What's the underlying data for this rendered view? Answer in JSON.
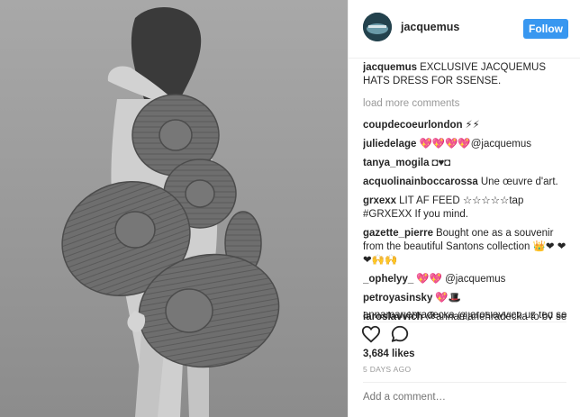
{
  "header": {
    "username": "jacquemus",
    "follow_label": "Follow"
  },
  "caption": {
    "username": "jacquemus",
    "text": "EXCLUSIVE JACQUEMUS HATS DRESS FOR SSENSE."
  },
  "load_more": "load more comments",
  "comments": [
    {
      "user": "coupdecoeurlondon",
      "text": "⚡⚡"
    },
    {
      "user": "juliedelage",
      "text": "💖💖💖💖@jacquemus"
    },
    {
      "user": "tanya_mogila",
      "text": "◘♥◘"
    },
    {
      "user": "acquolinainboccarossa",
      "text": "Une œuvre d'art."
    },
    {
      "user": "grxexx",
      "text": "LIT AF FEED ☆☆☆☆☆tap #GRXEXX If you mind."
    },
    {
      "user": "gazette_pierre",
      "text": "Bought one as a souvenir from the beautiful Santons collection 👑❤ ❤❤🙌🙌"
    },
    {
      "user": "_ophelyy_",
      "text": "💖💖 @jacquemus"
    },
    {
      "user": "petroyasinsky",
      "text": "💖🎩"
    },
    {
      "user": "jaroslavvich",
      "text": "@annamariehradecka to by se ti siklo!!!!"
    }
  ],
  "cutoff_comment": "annamariehradecka @jaroslavvich uz ted se",
  "likes": "3,684 likes",
  "timestamp": "5 DAYS AGO",
  "add_comment_placeholder": "Add a comment…",
  "colors": {
    "follow_bg": "#3897f0",
    "mention": "#003569",
    "muted": "#999999"
  },
  "icons": [
    "heart-icon",
    "comment-icon"
  ]
}
